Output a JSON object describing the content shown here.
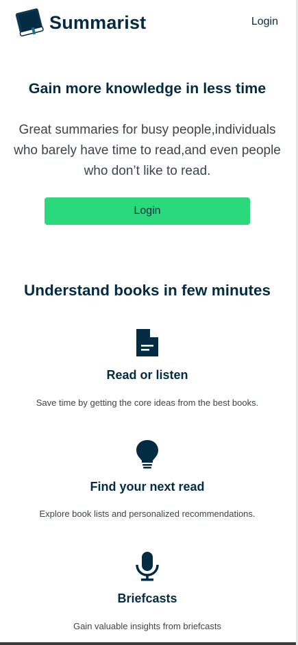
{
  "nav": {
    "logo_text": "Summarist",
    "login_label": "Login",
    "logo_icon": "book-icon"
  },
  "hero": {
    "title": "Gain more knowledge in less time",
    "subtitle": "Great summaries for busy people,individuals who barely have time to read,and even people who don’t like to read.",
    "login_label": "Login"
  },
  "features": {
    "title": "Understand books in few minutes",
    "items": [
      {
        "icon": "document-icon",
        "title": "Read or listen",
        "description": "Save time by getting the core ideas from the best books."
      },
      {
        "icon": "lightbulb-icon",
        "title": "Find your next read",
        "description": "Explore book lists and personalized recommendations."
      },
      {
        "icon": "microphone-icon",
        "title": "Briefcasts",
        "description": "Gain valuable insights from briefcasts"
      }
    ]
  },
  "colors": {
    "primary_text": "#032b41",
    "body_text": "#394547",
    "accent_green": "#2bd97c"
  }
}
